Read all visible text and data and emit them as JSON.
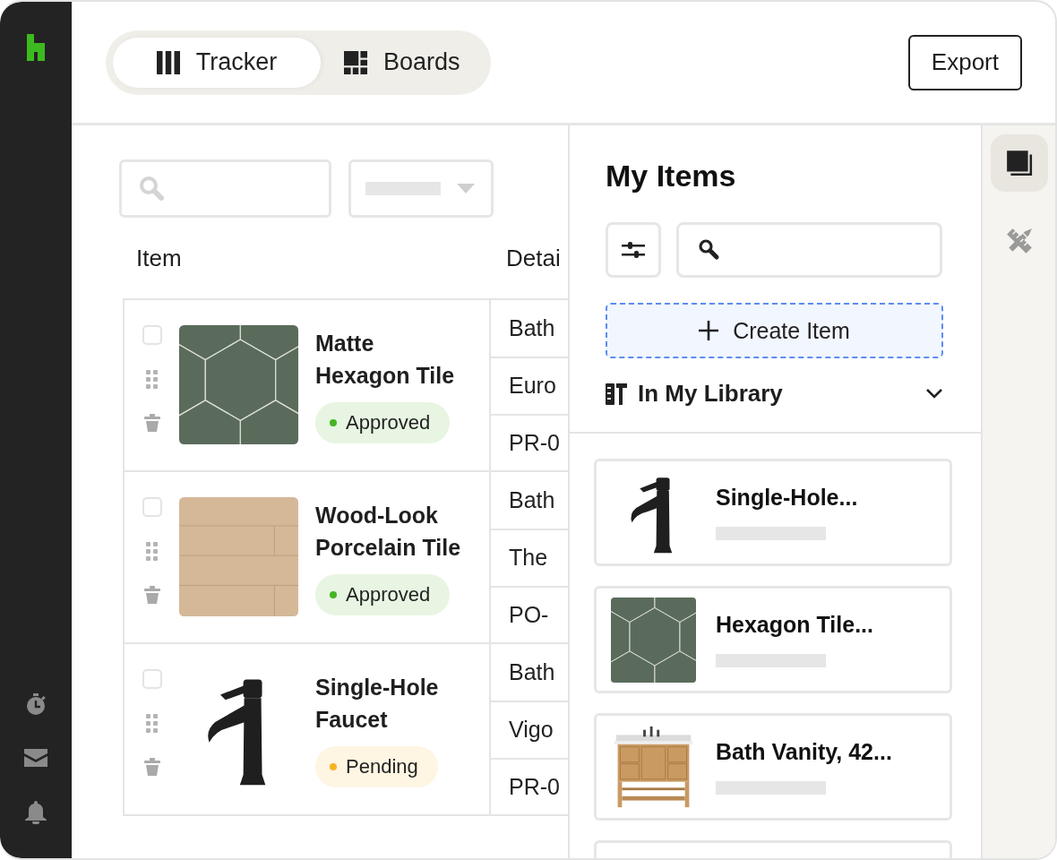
{
  "views": [
    {
      "label": "Tracker",
      "kind": "columns",
      "selected": true
    },
    {
      "label": "Boards",
      "kind": "grid",
      "selected": false
    }
  ],
  "export_button": {
    "label": "Export"
  },
  "tracker": {
    "columns": [
      "Item",
      "Detai"
    ],
    "rows": [
      {
        "name": "Matte Hexagon Tile",
        "kind": "hex-tile",
        "checked": false,
        "status": {
          "label": "Approved",
          "color": "#45b523"
        },
        "details": [
          "Bath",
          "Euro",
          "PR-0"
        ]
      },
      {
        "name": "Wood-Look Porcelain Tile",
        "kind": "wood-tile",
        "checked": false,
        "status": {
          "label": "Approved",
          "color": "#45b523"
        },
        "details": [
          "Bath",
          "The",
          "PO-"
        ]
      },
      {
        "name": "Single-Hole Faucet",
        "kind": "faucet",
        "checked": false,
        "status": {
          "label": "Pending",
          "color": "#f7b422"
        },
        "details": [
          "Bath",
          "Vigo",
          "PR-0"
        ]
      }
    ]
  },
  "panel": {
    "title": "My Items",
    "create_button": "Create Item",
    "section": {
      "label": "In My Library",
      "expanded": true
    },
    "cards": [
      {
        "title": "Single-Hole...",
        "kind": "faucet"
      },
      {
        "title": "Hexagon Tile...",
        "kind": "hex-tile"
      },
      {
        "title": "Bath Vanity, 42...",
        "kind": "vanity"
      }
    ]
  },
  "rail": {
    "tools": [
      {
        "kind": "pages",
        "selected": true
      },
      {
        "kind": "ruler-pencil",
        "selected": false
      }
    ]
  }
}
